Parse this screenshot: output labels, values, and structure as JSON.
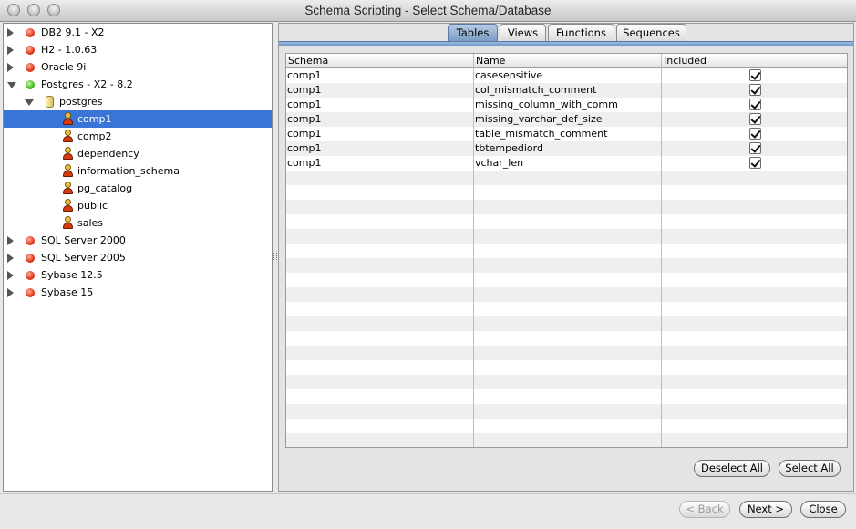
{
  "window": {
    "title": "Schema Scripting - Select Schema/Database"
  },
  "tree": {
    "items": [
      {
        "label": "DB2 9.1 - X2",
        "icon": "red-status-icon",
        "expanded": false,
        "level": 0
      },
      {
        "label": "H2 - 1.0.63",
        "icon": "red-status-icon",
        "expanded": false,
        "level": 0
      },
      {
        "label": "Oracle 9i",
        "icon": "red-status-icon",
        "expanded": false,
        "level": 0
      },
      {
        "label": "Postgres - X2 - 8.2",
        "icon": "green-status-icon",
        "expanded": true,
        "level": 0
      },
      {
        "label": "postgres",
        "icon": "database-icon",
        "expanded": true,
        "level": 1
      },
      {
        "label": "comp1",
        "icon": "schema-user-icon",
        "selected": true,
        "level": 2
      },
      {
        "label": "comp2",
        "icon": "schema-user-icon",
        "level": 2
      },
      {
        "label": "dependency",
        "icon": "schema-user-icon",
        "level": 2
      },
      {
        "label": "information_schema",
        "icon": "schema-user-icon",
        "level": 2
      },
      {
        "label": "pg_catalog",
        "icon": "schema-user-icon",
        "level": 2
      },
      {
        "label": "public",
        "icon": "schema-user-icon",
        "level": 2
      },
      {
        "label": "sales",
        "icon": "schema-user-icon",
        "level": 2
      },
      {
        "label": "SQL Server 2000",
        "icon": "red-status-icon",
        "expanded": false,
        "level": 0
      },
      {
        "label": "SQL Server 2005",
        "icon": "red-status-icon",
        "expanded": false,
        "level": 0
      },
      {
        "label": "Sybase 12.5",
        "icon": "red-status-icon",
        "expanded": false,
        "level": 0
      },
      {
        "label": "Sybase 15",
        "icon": "red-status-icon",
        "expanded": false,
        "level": 0
      }
    ]
  },
  "tabs": [
    {
      "label": "Tables",
      "active": true
    },
    {
      "label": "Views",
      "active": false
    },
    {
      "label": "Functions",
      "active": false
    },
    {
      "label": "Sequences",
      "active": false
    }
  ],
  "table": {
    "columns": [
      "Schema",
      "Name",
      "Included"
    ],
    "rows": [
      {
        "schema": "comp1",
        "name": "casesensitive",
        "included": true
      },
      {
        "schema": "comp1",
        "name": "col_mismatch_comment",
        "included": true
      },
      {
        "schema": "comp1",
        "name": "missing_column_with_comm",
        "included": true
      },
      {
        "schema": "comp1",
        "name": "missing_varchar_def_size",
        "included": true
      },
      {
        "schema": "comp1",
        "name": "table_mismatch_comment",
        "included": true
      },
      {
        "schema": "comp1",
        "name": "tbtempediord",
        "included": true
      },
      {
        "schema": "comp1",
        "name": "vchar_len",
        "included": true
      }
    ]
  },
  "buttons": {
    "deselect_all": "Deselect All",
    "select_all": "Select All",
    "back": "< Back",
    "next": "Next >",
    "close": "Close"
  },
  "colors": {
    "selection": "#3875d7",
    "tab_active": "#7b9dc6"
  }
}
